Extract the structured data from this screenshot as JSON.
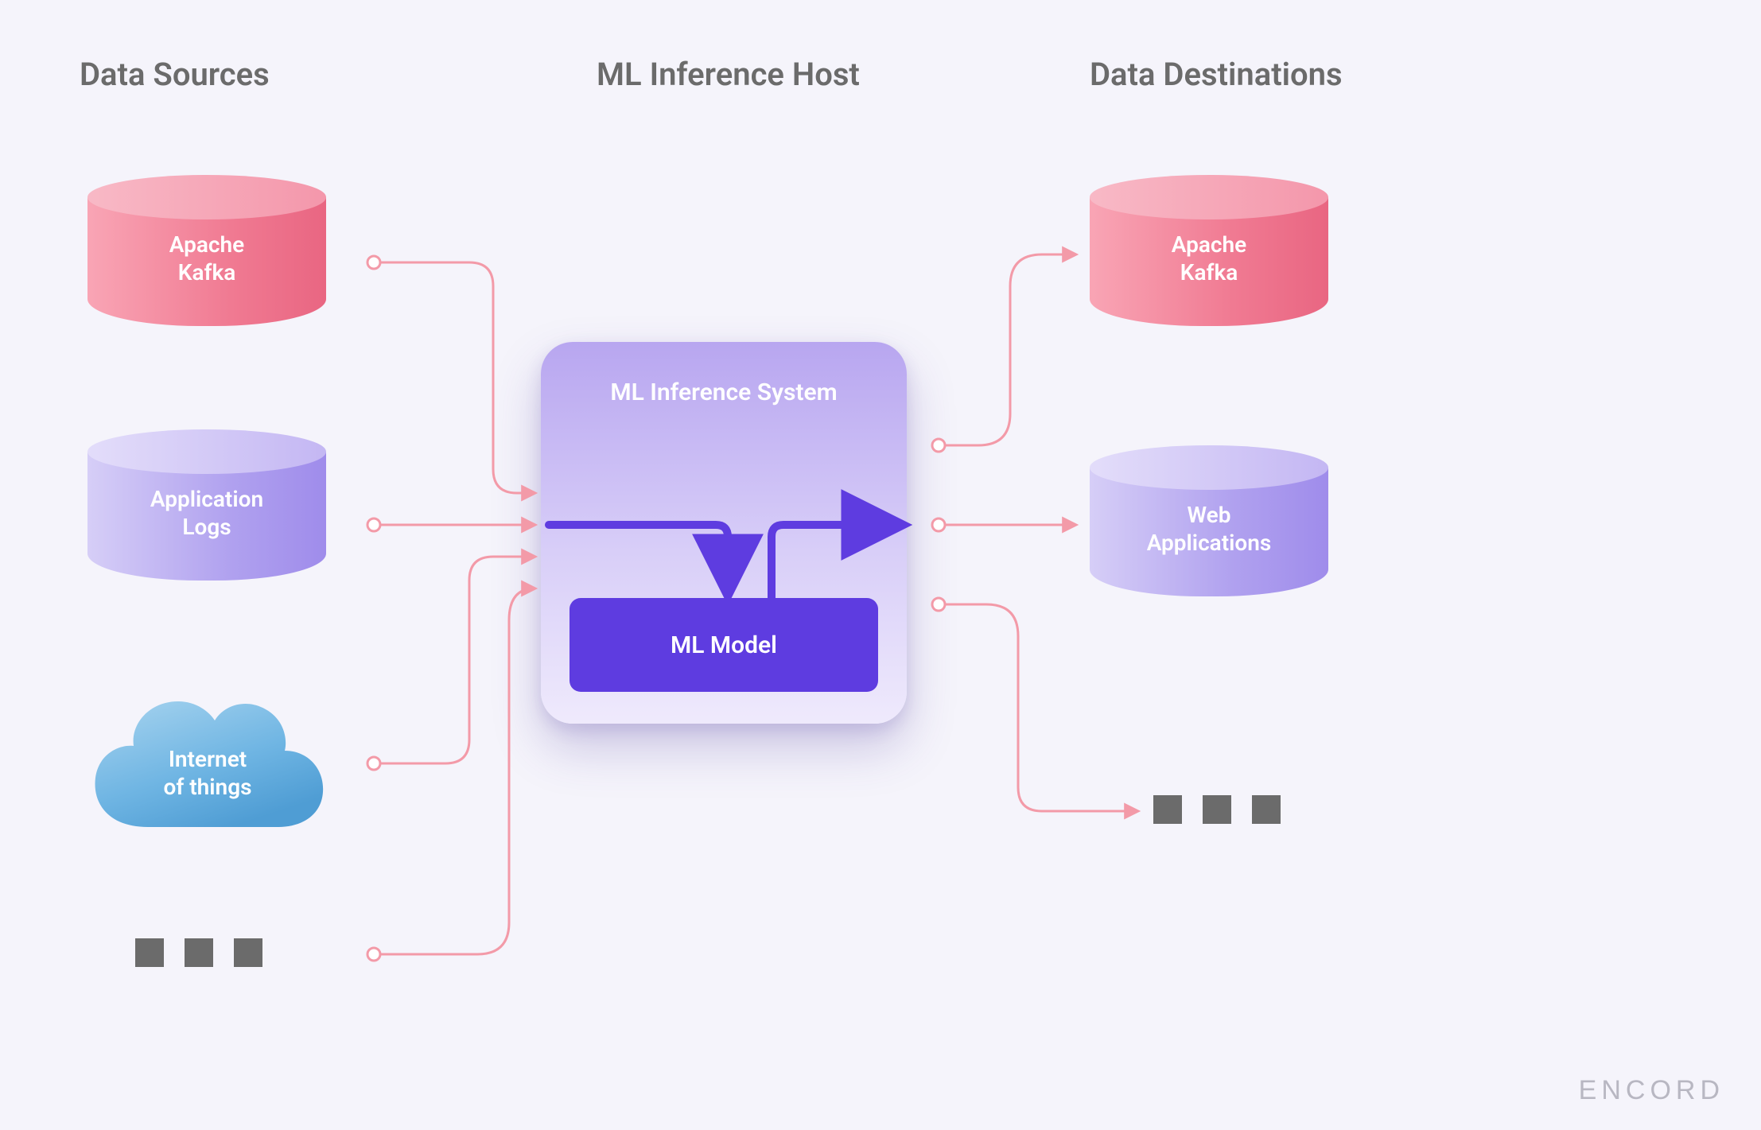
{
  "headings": {
    "sources": "Data Sources",
    "host": "ML Inference Host",
    "destinations": "Data Destinations"
  },
  "sources": {
    "kafka": "Apache\nKafka",
    "applogs": "Application\nLogs",
    "iot": "Internet\nof things"
  },
  "host_card": {
    "title": "ML Inference System",
    "model": "ML Model"
  },
  "destinations": {
    "kafka": "Apache\nKafka",
    "webapps": "Web\nApplications"
  },
  "brand": "ENCORD",
  "colors": {
    "connector": "#f39aa8",
    "flow": "#5e3ce0"
  }
}
